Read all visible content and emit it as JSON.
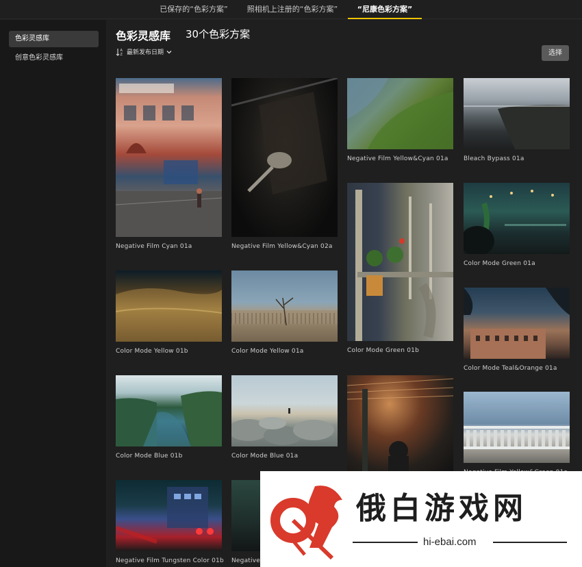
{
  "tabs": [
    {
      "label": "已保存的“色彩方案”"
    },
    {
      "label": "照相机上注册的“色彩方案”"
    },
    {
      "label": "“尼康色彩方案”"
    }
  ],
  "sidebar": {
    "items": [
      {
        "label": "色彩灵感库"
      },
      {
        "label": "创意色彩灵感库"
      }
    ]
  },
  "main": {
    "title": "色彩灵感库",
    "count": "30个色彩方案",
    "sort_label": "最新发布日期",
    "select_label": "选择"
  },
  "cards": [
    {
      "label": "Negative Film Cyan 01a"
    },
    {
      "label": "Negative Film Yellow&Cyan 02a"
    },
    {
      "label": "Negative Film Yellow&Cyan 01a"
    },
    {
      "label": "Bleach Bypass 01a"
    },
    {
      "label": "Color Mode Green 01b"
    },
    {
      "label": "Color Mode Green 01a"
    },
    {
      "label": "Color Mode Yellow 01b"
    },
    {
      "label": "Color Mode Yellow 01a"
    },
    {
      "label": "Color Mode Teal&Orange 01a"
    },
    {
      "label": "Color Mode Blue 01b"
    },
    {
      "label": "Color Mode Blue 01a"
    },
    {
      "label": ""
    },
    {
      "label": "Negative Film Yellow&Green 01a"
    },
    {
      "label": "Negative Film Tungsten Color 01b"
    },
    {
      "label": "Negative F"
    }
  ],
  "watermark": {
    "text": "俄白游戏网",
    "url": "hi-ebai.com"
  },
  "colors": {
    "accent": "#f0c400",
    "background": "#1f1f1f",
    "sidebar": "#181818",
    "watermark_red": "#d93a2b"
  }
}
